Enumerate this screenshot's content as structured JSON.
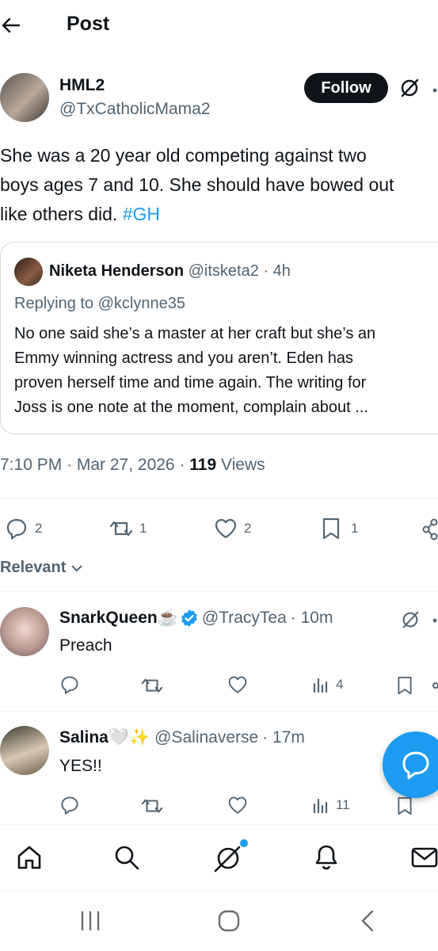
{
  "header": {
    "title": "Post"
  },
  "post": {
    "author_name": "HML2",
    "author_handle": "@TxCatholicMama2",
    "follow_label": "Follow",
    "text_lines": [
      "She was a 20 year old competing against two",
      "boys ages 7 and 10. She should have bowed out",
      "like others did. "
    ],
    "hashtag": "#GH",
    "quote": {
      "name": "Niketa Henderson",
      "handle": "@itsketa2",
      "time": "· 4h",
      "replying_prefix": "Replying to ",
      "replying_handle": "@kclynne35",
      "lines": [
        "No one said she’s a master at her craft but she’s an",
        "Emmy winning actress and you aren’t. Eden has",
        "proven herself time and time again. The writing for",
        "Joss is one note at the moment, complain about ..."
      ]
    },
    "timestamp": "7:10 PM · Mar 27, 2026 · ",
    "views_count": "119",
    "views_label": " Views",
    "actions": {
      "replies": "2",
      "reposts": "1",
      "likes": "2",
      "bookmarks": "1"
    }
  },
  "sort": {
    "label": "Relevant"
  },
  "replies": [
    {
      "name": "SnarkQueen",
      "emoji": "☕",
      "handle": "@TracyTea",
      "time": "· 10m",
      "text": "Preach",
      "views": "4"
    },
    {
      "name": "Salina",
      "emoji": "🤍✨",
      "handle": "@Salinaverse",
      "time": "· 17m",
      "text": "YES!!",
      "views": "11"
    }
  ],
  "colors": {
    "accent": "#1d9bf0",
    "text": "#0f1419",
    "muted": "#536471",
    "verified": "#1d9bf0"
  },
  "icons": [
    "back-arrow-icon",
    "grok-icon",
    "more-icon",
    "reply-icon",
    "repost-icon",
    "like-icon",
    "bookmark-icon",
    "share-icon",
    "views-icon",
    "verified-icon",
    "chevron-down-icon",
    "compose-icon",
    "home-icon",
    "search-icon",
    "notifications-icon",
    "messages-icon",
    "recent-apps-icon",
    "system-home-icon",
    "system-back-icon"
  ]
}
